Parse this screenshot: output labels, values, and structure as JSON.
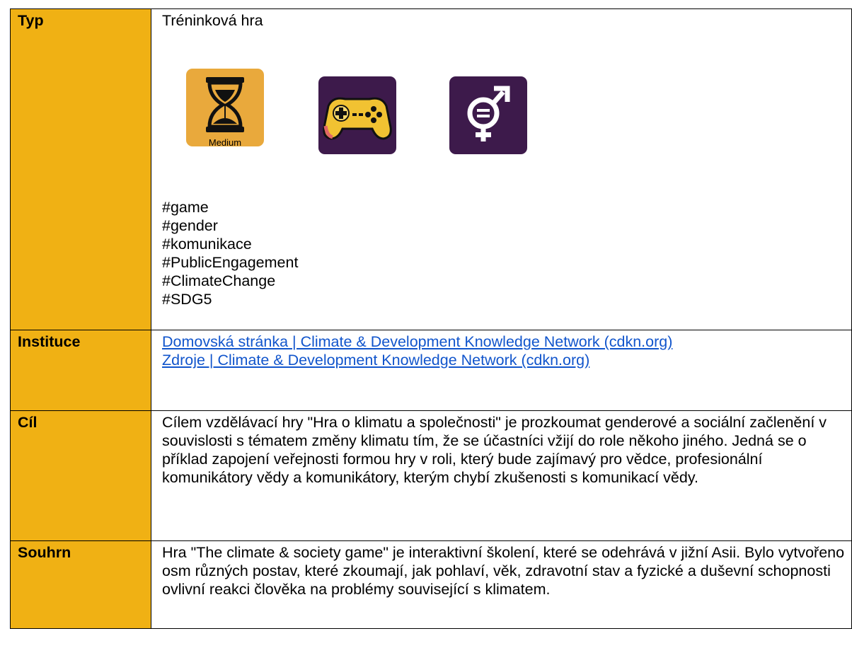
{
  "rows": {
    "typ": {
      "label": "Typ",
      "value": "Tréninková hra",
      "icons": [
        {
          "name": "hourglass-icon",
          "caption": "Medium",
          "bg": "#E9A93C"
        },
        {
          "name": "gamepad-icon",
          "bg": "#3D1A4B"
        },
        {
          "name": "gender-equality-icon",
          "bg": "#3D1A4B"
        }
      ],
      "tags": [
        "#game",
        "#gender",
        "#komunikace",
        "#PublicEngagement",
        "#ClimateChange",
        "#SDG5"
      ]
    },
    "instituce": {
      "label": "Instituce",
      "links": [
        "Domovská stránka | Climate & Development Knowledge Network (cdkn.org)",
        "Zdroje | Climate & Development Knowledge Network (cdkn.org)"
      ]
    },
    "cil": {
      "label": "Cíl",
      "text": "Cílem vzdělávací hry \"Hra o klimatu a společnosti\" je prozkoumat genderové a sociální začlenění v souvislosti s tématem změny klimatu tím, že se účastníci vžijí do role někoho jiného. Jedná se o příklad zapojení veřejnosti formou hry v roli, který bude zajímavý pro vědce, profesionální komunikátory vědy a komunikátory, kterým chybí zkušenosti s komunikací vědy."
    },
    "souhrn": {
      "label": "Souhrn",
      "text": "Hra \"The climate & society game\" je interaktivní školení, které se odehrává v jižní Asii. Bylo vytvořeno osm různých postav, které zkoumají, jak pohlaví, věk, zdravotní stav a fyzické a duševní schopnosti ovlivní reakci člověka na problémy související s klimatem."
    }
  },
  "colors": {
    "label_bg": "#F0B114",
    "link": "#1155CC",
    "icon_orange": "#E9A93C",
    "icon_purple": "#3D1A4B"
  }
}
